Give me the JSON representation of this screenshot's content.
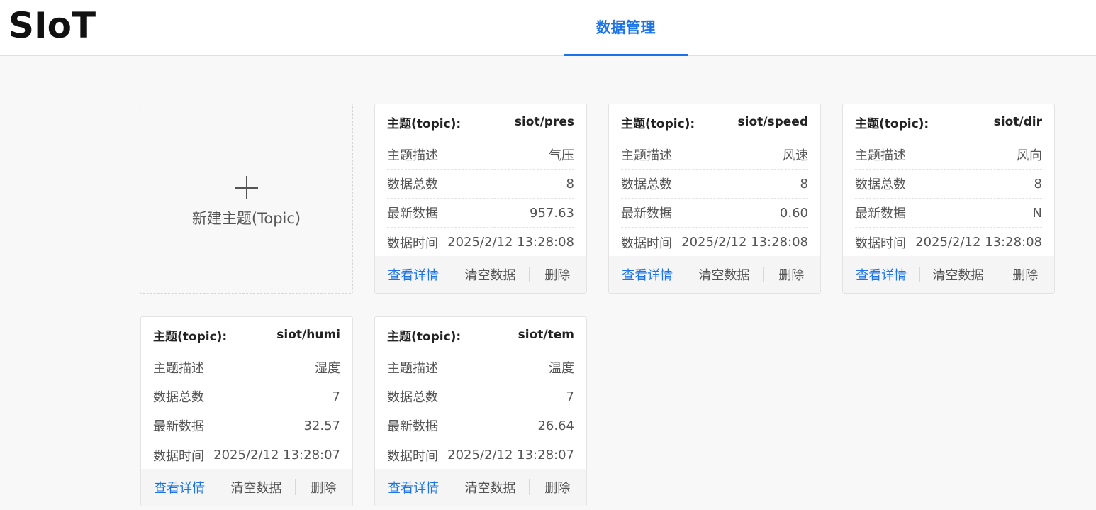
{
  "app": {
    "logo": "SIoT"
  },
  "nav": {
    "tab_label": "数据管理"
  },
  "new_topic": {
    "label": "新建主题(Topic)"
  },
  "labels": {
    "topic": "主题(topic):",
    "desc": "主题描述",
    "count": "数据总数",
    "latest": "最新数据",
    "time": "数据时间"
  },
  "actions": {
    "detail": "查看详情",
    "clear": "清空数据",
    "delete": "删除"
  },
  "cards": [
    {
      "topic": "siot/pres",
      "desc": "气压",
      "count": "8",
      "latest": "957.63",
      "time": "2025/2/12 13:28:08"
    },
    {
      "topic": "siot/speed",
      "desc": "风速",
      "count": "8",
      "latest": "0.60",
      "time": "2025/2/12 13:28:08"
    },
    {
      "topic": "siot/dir",
      "desc": "风向",
      "count": "8",
      "latest": "N",
      "time": "2025/2/12 13:28:08"
    },
    {
      "topic": "siot/humi",
      "desc": "湿度",
      "count": "7",
      "latest": "32.57",
      "time": "2025/2/12 13:28:07"
    },
    {
      "topic": "siot/tem",
      "desc": "温度",
      "count": "7",
      "latest": "26.64",
      "time": "2025/2/12 13:28:07"
    }
  ]
}
